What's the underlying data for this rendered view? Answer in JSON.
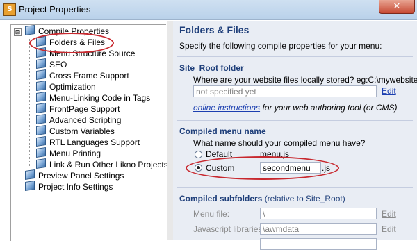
{
  "window": {
    "title": "Project Properties",
    "app_icon_glyph": "S",
    "close_glyph": "✕"
  },
  "tree": {
    "root": {
      "label": "Compile Properties",
      "expander": "⊟"
    },
    "children": [
      "Folders & Files",
      "Menu Structure Source",
      "SEO",
      "Cross Frame Support",
      "Optimization",
      "Menu-Linking Code in Tags",
      "FrontPage Support",
      "Advanced Scripting",
      "Custom Variables",
      "RTL Languages Support",
      "Menu Printing",
      "Link & Run Other Likno Projects"
    ],
    "siblings": [
      "Preview Panel Settings",
      "Project Info Settings"
    ]
  },
  "panel": {
    "title": "Folders & Files",
    "subtitle": "Specify the following compile properties for your menu:",
    "site_root": {
      "title": "Site_Root folder",
      "question": "Where are your website files locally stored?  eg:C:\\mywebsite",
      "value": "not specified yet",
      "edit": "Edit",
      "link": "online instructions",
      "link_suffix": "for your web authoring tool (or CMS)"
    },
    "compiled_name": {
      "title": "Compiled menu name",
      "question": "What name should your compiled menu have?",
      "default_label": "Default",
      "default_value": "menu.js",
      "custom_label": "Custom",
      "custom_value": "secondmenu",
      "custom_ext": ".js"
    },
    "subfolders": {
      "title": "Compiled subfolders",
      "note": "(relative to Site_Root)",
      "menu_file_label": "Menu file:",
      "menu_file_value": "\\",
      "js_label": "Javascript libraries:",
      "js_value": "\\awmdata",
      "edit": "Edit"
    }
  },
  "colors": {
    "heading": "#1f3f7a",
    "link": "#1c3fb0",
    "annotation": "#c8282e",
    "panel_bg": "#e9edf4"
  },
  "icons": {
    "tree_item": "cube-icon",
    "close": "close-icon",
    "app": "app-icon"
  }
}
